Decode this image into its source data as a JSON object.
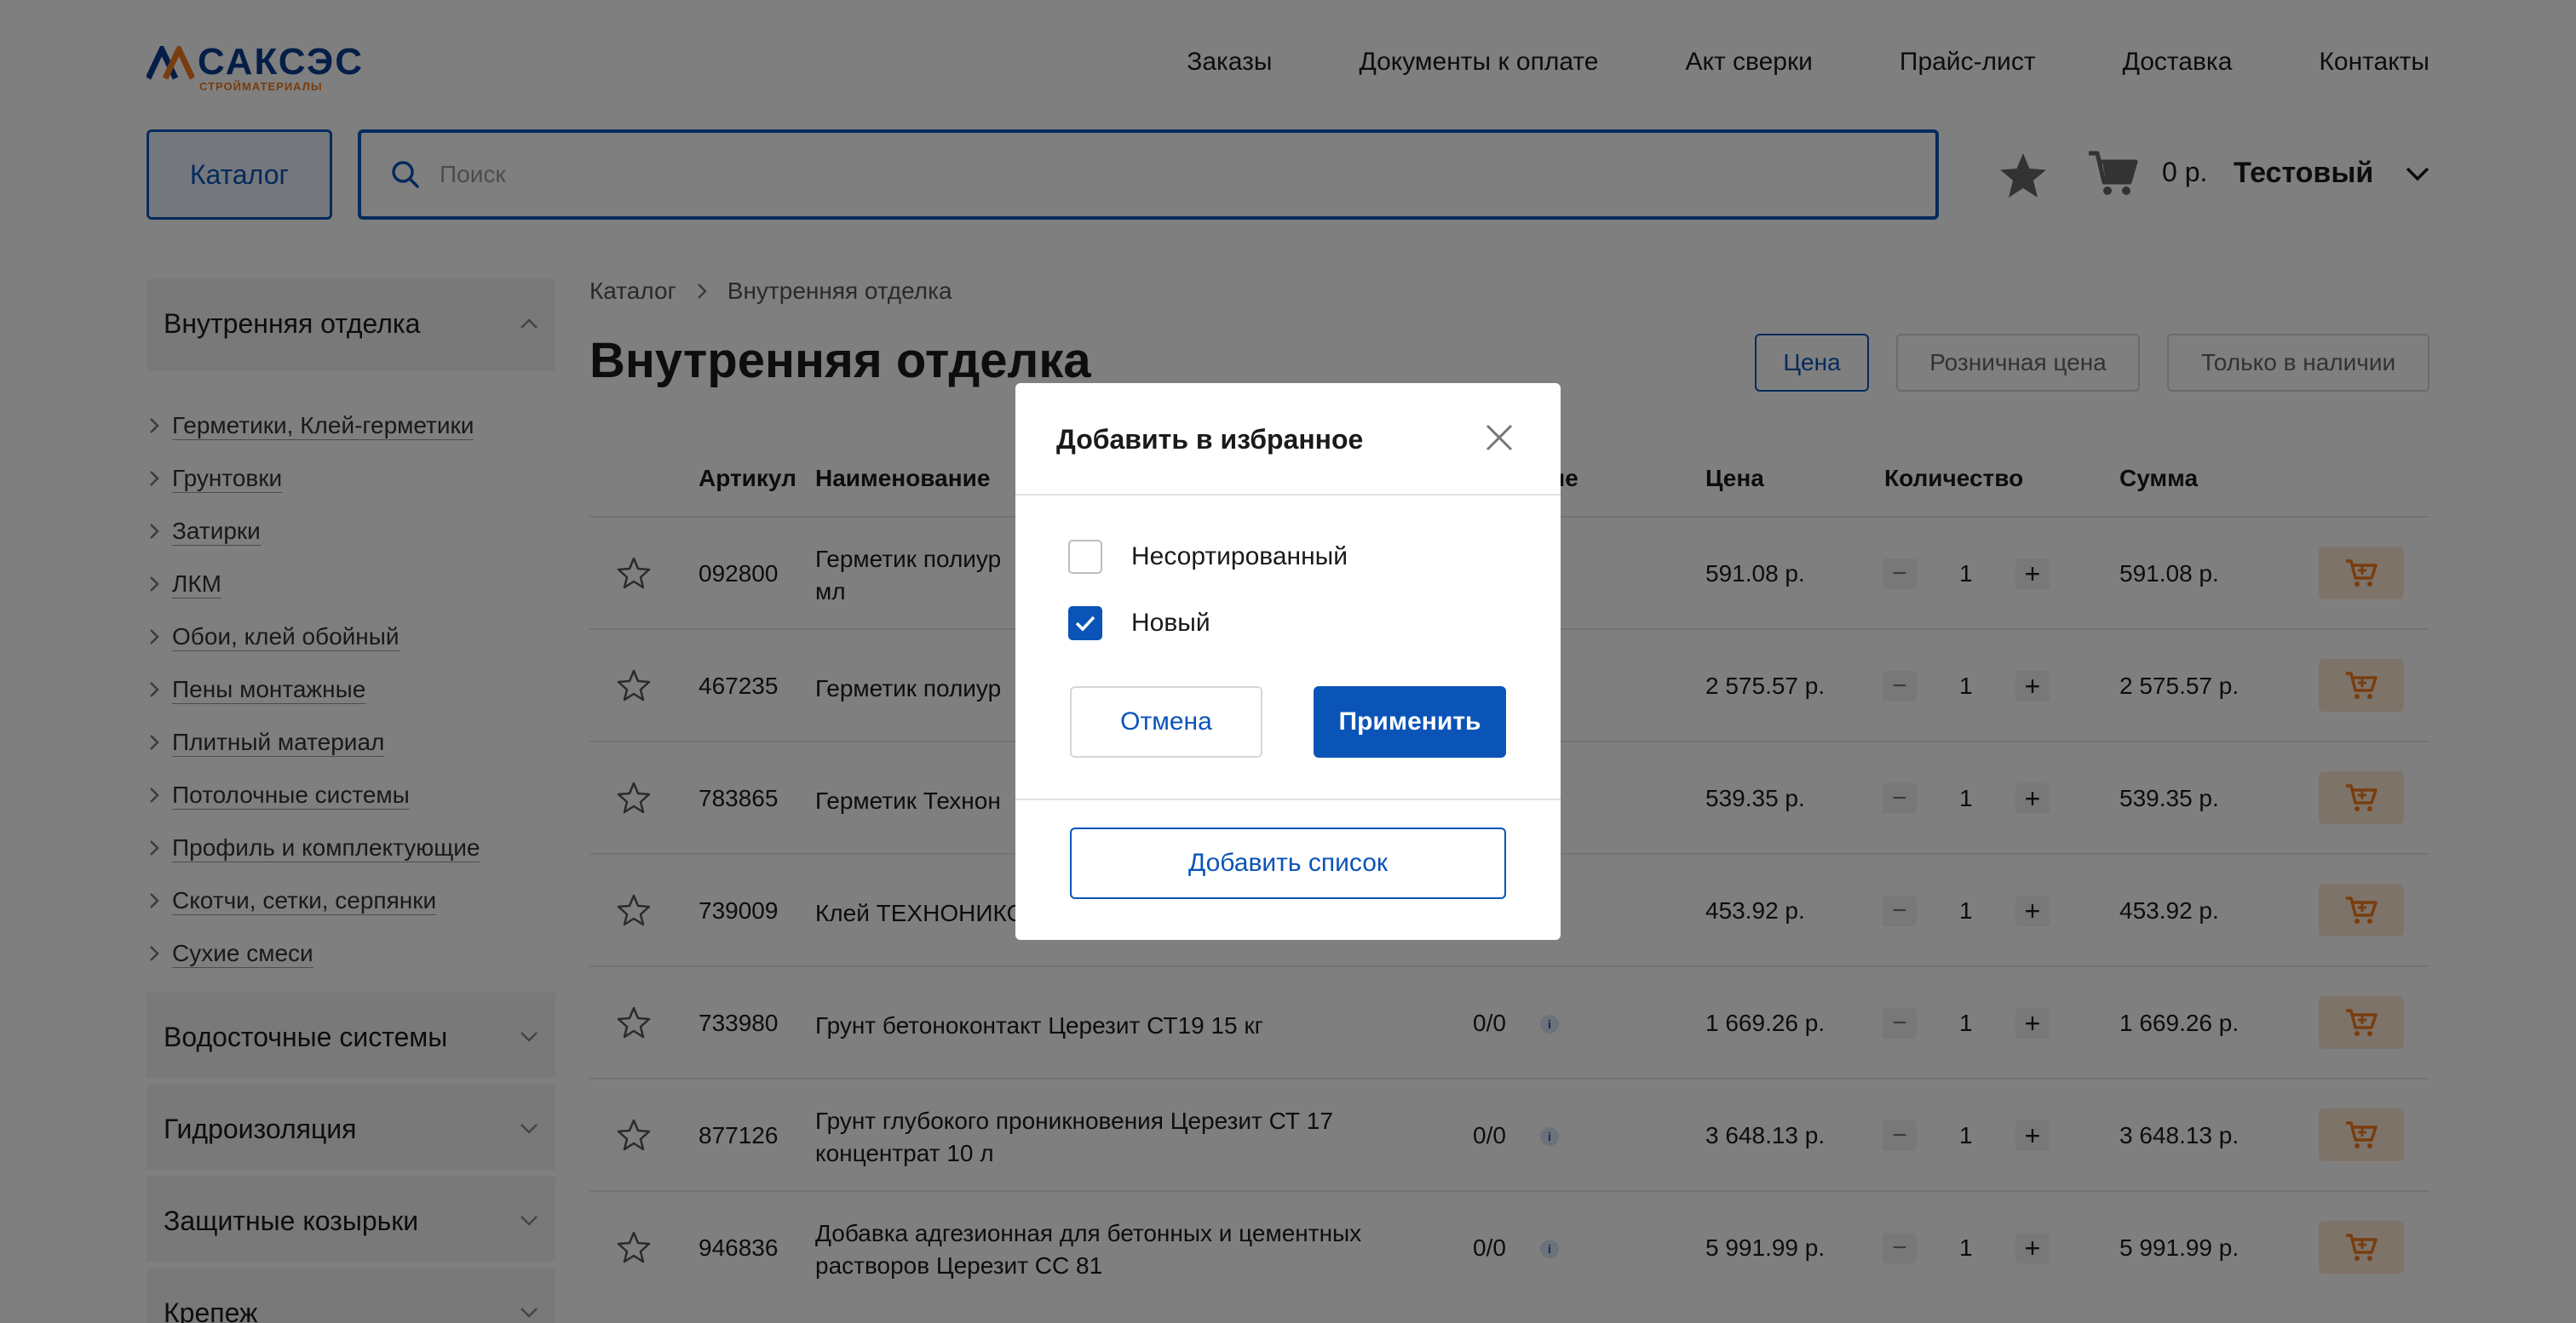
{
  "header": {
    "logo_word": "САКСЭС",
    "logo_sub": "СТРОЙМАТЕРИАЛЫ",
    "nav": [
      "Заказы",
      "Документы к оплате",
      "Акт сверки",
      "Прайс-лист",
      "Доставка",
      "Контакты"
    ],
    "catalog_label": "Каталог",
    "search_placeholder": "Поиск",
    "cart_sum": "0 р.",
    "user_name": "Тестовый"
  },
  "sidebar": {
    "open_group": "Внутренняя отделка",
    "sub_items": [
      "Герметики, Клей-герметики",
      "Грунтовки",
      "Затирки",
      "ЛКМ",
      "Обои, клей обойный",
      "Пены монтажные",
      "Плитный материал",
      "Потолочные системы",
      "Профиль и комплектующие",
      "Скотчи, сетки, серпянки",
      "Сухие смеси"
    ],
    "groups": [
      "Водосточные системы",
      "Гидроизоляция",
      "Защитные козырьки",
      "Крепеж"
    ]
  },
  "main": {
    "breadcrumb": [
      "Каталог",
      "Внутренняя отделка"
    ],
    "title": "Внутренняя отделка",
    "filters": [
      "Цена",
      "Розничная цена",
      "Только в наличии"
    ],
    "columns": {
      "article": "Артикул",
      "name": "Наименование",
      "stock_tail": "ие",
      "price": "Цена",
      "qty": "Количество",
      "sum": "Сумма"
    },
    "rows": [
      {
        "article": "092800",
        "name": "Герметик полиур",
        "name2": "мл",
        "stock": "",
        "info": false,
        "price": "591.08 р.",
        "qty": "1",
        "sum": "591.08 р."
      },
      {
        "article": "467235",
        "name": "Герметик полиур",
        "name2": "",
        "stock": "",
        "info": true,
        "price": "2 575.57 р.",
        "qty": "1",
        "sum": "2 575.57 р."
      },
      {
        "article": "783865",
        "name": "Герметик Технон",
        "name2": "",
        "stock": "",
        "info": true,
        "price": "539.35 р.",
        "qty": "1",
        "sum": "539.35 р."
      },
      {
        "article": "739009",
        "name": "Клей ТЕХНОНИКС",
        "name2": "",
        "stock": "",
        "info": false,
        "price": "453.92 р.",
        "qty": "1",
        "sum": "453.92 р."
      },
      {
        "article": "733980",
        "name": "Грунт бетоноконтакт Церезит СТ19 15 кг",
        "name2": "",
        "stock": "0/0",
        "info": true,
        "price": "1 669.26 р.",
        "qty": "1",
        "sum": "1 669.26 р."
      },
      {
        "article": "877126",
        "name": "Грунт глубокого проникновения Церезит СТ 17",
        "name2": "концентрат 10 л",
        "stock": "0/0",
        "info": true,
        "price": "3 648.13 р.",
        "qty": "1",
        "sum": "3 648.13 р."
      },
      {
        "article": "946836",
        "name": "Добавка адгезионная для бетонных и цементных",
        "name2": "растворов Церезит СС 81",
        "stock": "0/0",
        "info": true,
        "price": "5 991.99 р.",
        "qty": "1",
        "sum": "5 991.99 р."
      }
    ],
    "info_glyph": "i",
    "minus_glyph": "−",
    "plus_glyph": "+"
  },
  "modal": {
    "title": "Добавить в избранное",
    "options": [
      {
        "label": "Несортированный",
        "checked": false
      },
      {
        "label": "Новый",
        "checked": true
      }
    ],
    "cancel_label": "Отмена",
    "apply_label": "Применить",
    "add_list_label": "Добавить список"
  },
  "colors": {
    "accent": "#0a54b8",
    "logo_blue": "#0a3d91",
    "logo_orange": "#f07b1f",
    "cart_orange": "#f07b1f",
    "overlay": "rgba(0,0,0,0.5)"
  }
}
